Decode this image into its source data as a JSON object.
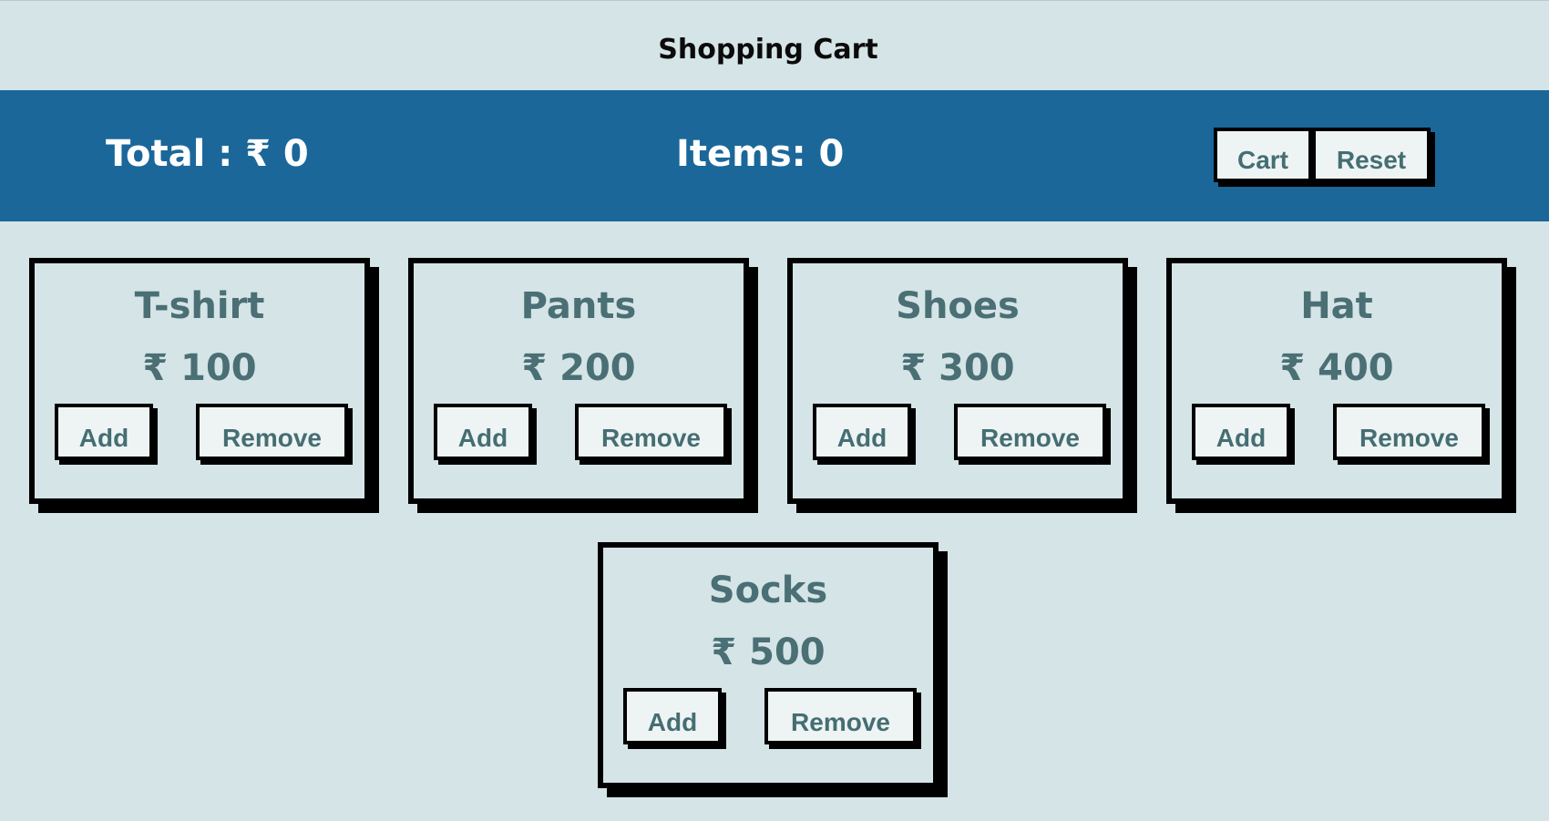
{
  "header": {
    "title": "Shopping Cart"
  },
  "summary": {
    "total_label": "Total : ₹ 0",
    "items_label": "Items: 0",
    "cart_button": "Cart",
    "reset_button": "Reset"
  },
  "products": [
    {
      "name": "T-shirt",
      "price": "₹ 100",
      "add": "Add",
      "remove": "Remove"
    },
    {
      "name": "Pants",
      "price": "₹ 200",
      "add": "Add",
      "remove": "Remove"
    },
    {
      "name": "Shoes",
      "price": "₹ 300",
      "add": "Add",
      "remove": "Remove"
    },
    {
      "name": "Hat",
      "price": "₹ 400",
      "add": "Add",
      "remove": "Remove"
    },
    {
      "name": "Socks",
      "price": "₹ 500",
      "add": "Add",
      "remove": "Remove"
    }
  ],
  "colors": {
    "background": "#d5e4e6",
    "bar": "#1b679a",
    "product_text": "#4a6f74",
    "button_bg": "#eef4f4"
  }
}
